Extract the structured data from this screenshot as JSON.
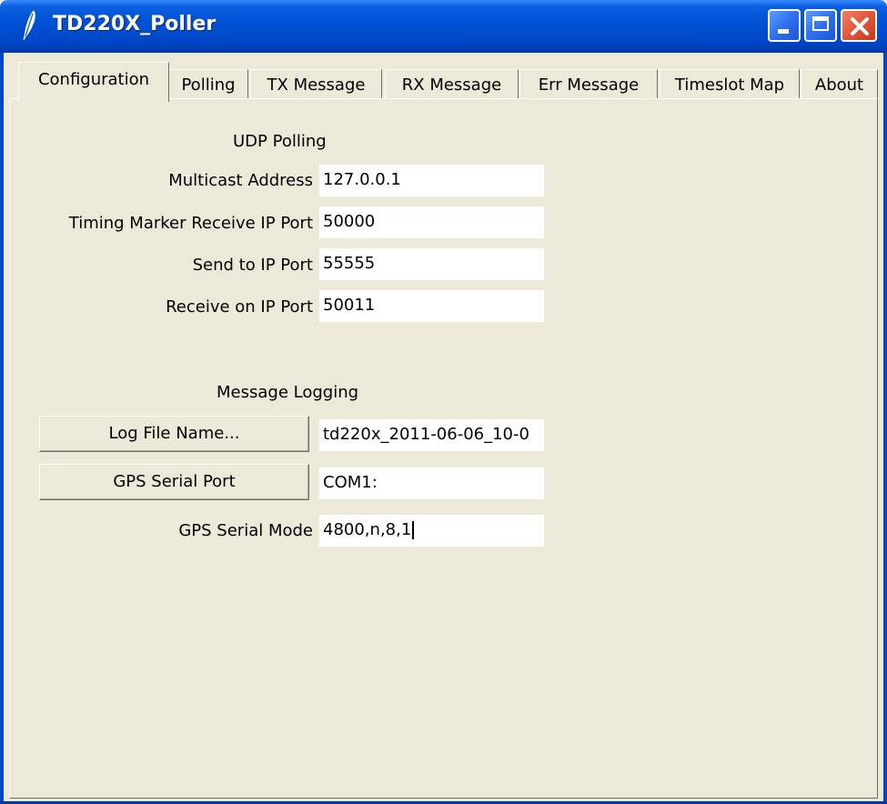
{
  "window": {
    "title": "TD220X_Poller",
    "icon": "feather-icon",
    "controls": [
      "minimize-icon",
      "maximize-icon",
      "close-icon"
    ]
  },
  "tabs": [
    {
      "label": "Configuration",
      "active": true
    },
    {
      "label": "Polling",
      "active": false
    },
    {
      "label": "TX Message",
      "active": false
    },
    {
      "label": "RX Message",
      "active": false
    },
    {
      "label": "Err Message",
      "active": false
    },
    {
      "label": "Timeslot Map",
      "active": false
    },
    {
      "label": "About",
      "active": false
    }
  ],
  "udp": {
    "title": "UDP Polling",
    "multicast_label": "Multicast Address",
    "multicast_value": "127.0.0.1",
    "timing_label": "Timing Marker Receive IP Port",
    "timing_value": "50000",
    "send_label": "Send to IP Port",
    "send_value": "55555",
    "receive_label": "Receive on IP Port",
    "receive_value": "50011"
  },
  "logging": {
    "title": "Message Logging",
    "log_button": "Log File Name...",
    "log_value": "td220x_2011-06-06_10-0",
    "gps_port_button": "GPS Serial Port",
    "gps_port_value": "COM1:",
    "gps_mode_label": "GPS Serial Mode",
    "gps_mode_value": "4800,n,8,1"
  },
  "colors": {
    "titlebar": "#0052d6",
    "face": "#ece9d8",
    "close": "#e2553a"
  }
}
